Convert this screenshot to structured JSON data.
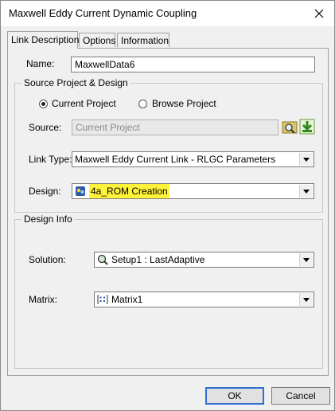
{
  "window": {
    "title": "Maxwell Eddy Current Dynamic Coupling"
  },
  "tabs": [
    {
      "label": "Link Description",
      "active": true
    },
    {
      "label": "Options",
      "active": false
    },
    {
      "label": "Information",
      "active": false
    }
  ],
  "name": {
    "label": "Name:",
    "value": "MaxwellData6"
  },
  "source_group": {
    "title": "Source Project & Design",
    "current_project_label": "Current Project",
    "browse_project_label": "Browse Project",
    "source_label": "Source:",
    "source_value": "Current Project",
    "link_type_label": "Link Type:",
    "link_type_value": "Maxwell Eddy Current Link - RLGC Parameters",
    "design_label": "Design:",
    "design_value": "4a_ROM Creation"
  },
  "design_info": {
    "title": "Design Info",
    "solution_label": "Solution:",
    "solution_value": "Setup1 : LastAdaptive",
    "matrix_label": "Matrix:",
    "matrix_value": "Matrix1"
  },
  "buttons": {
    "ok": "OK",
    "cancel": "Cancel"
  },
  "colors": {
    "highlight": "#fff23a",
    "default_button_border": "#2f6fd0"
  }
}
